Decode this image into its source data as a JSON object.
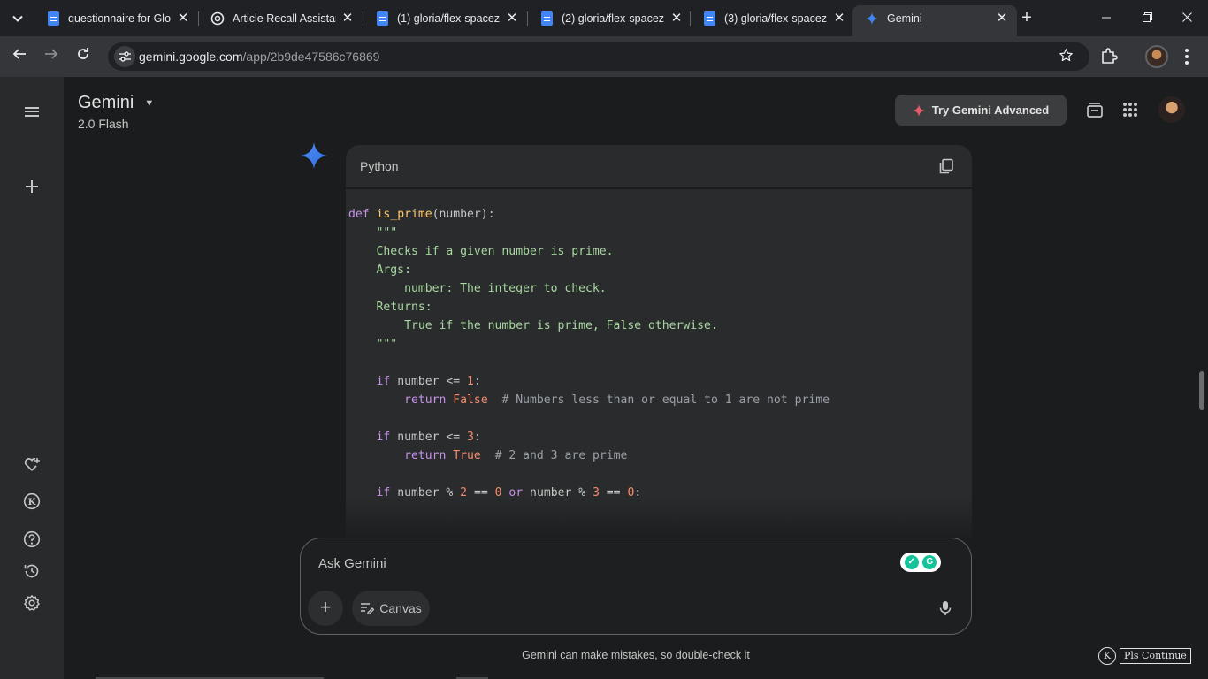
{
  "browser": {
    "tabs": [
      {
        "title": "questionnaire for Glo",
        "icon": "google-docs-icon"
      },
      {
        "title": "Article Recall Assistan",
        "icon": "chatgpt-icon"
      },
      {
        "title": "(1) gloria/flex-spacez",
        "icon": "google-docs-icon"
      },
      {
        "title": "(2) gloria/flex-spacez",
        "icon": "google-docs-icon"
      },
      {
        "title": "(3) gloria/flex-spacez",
        "icon": "google-docs-icon"
      },
      {
        "title": "Gemini",
        "icon": "gemini-icon",
        "active": true
      }
    ],
    "url_domain": "gemini.google.com",
    "url_path": "/app/2b9de47586c76869"
  },
  "header": {
    "brand": "Gemini",
    "model": "2.0 Flash",
    "try_advanced": "Try Gemini Advanced"
  },
  "code_block": {
    "language": "Python",
    "lines": [
      "def is_prime(number):",
      "    \"\"\"",
      "    Checks if a given number is prime.",
      "",
      "    Args:",
      "        number: The integer to check.",
      "",
      "    Returns:",
      "        True if the number is prime, False otherwise.",
      "    \"\"\"",
      "",
      "    if number <= 1:",
      "        return False  # Numbers less than or equal to 1 are not prime",
      "",
      "    if number <= 3:",
      "        return True  # 2 and 3 are prime",
      "",
      "    if number % 2 == 0 or number % 3 == 0:"
    ]
  },
  "input": {
    "placeholder": "Ask Gemini",
    "canvas_label": "Canvas"
  },
  "disclaimer": "Gemini can make mistakes, so double-check it",
  "extension_button": "Pls Continue",
  "colors": {
    "background": "#1b1c1d",
    "sidebar": "#282a2c",
    "code_background": "#2a2b2d",
    "keyword": "#c792ea",
    "function": "#ffcb6b",
    "docstring": "#a8d8a0",
    "number": "#f78c6c",
    "comment": "#9aa0a6",
    "gemini_blue": "#4285f4"
  }
}
